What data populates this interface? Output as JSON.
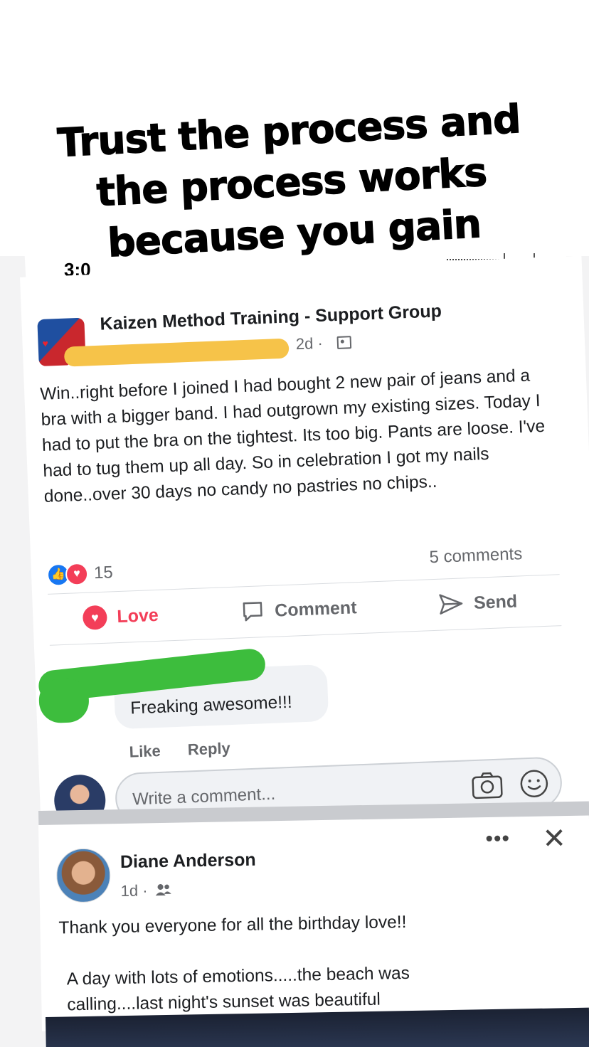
{
  "headline": "Trust the process and the process works because you gain consistency!",
  "status_bar": {
    "time": "3:0"
  },
  "post1": {
    "group_name": "Kaizen Method Training - Support Group",
    "time": "2d ·",
    "body": "Win..right before I joined I had bought 2 new pair of jeans and a bra with a bigger band. I had outgrown my existing sizes. Today I had to put the bra on the tightest. Its too big. Pants are loose. I've had to tug them up all day.  So in celebration I got my nails done..over 30 days no candy no pastries no chips..",
    "reaction_count": "15",
    "comments_count": "5 comments",
    "actions": {
      "love": "Love",
      "comment": "Comment",
      "send": "Send"
    },
    "comment": {
      "text": "Freaking awesome!!!",
      "like": "Like",
      "reply": "Reply"
    },
    "write_comment_placeholder": "Write a comment..."
  },
  "post2": {
    "name": "Diane Anderson",
    "time": "1d ·",
    "body_line1": "Thank you everyone for all the birthday love!!",
    "body_line2": "A day with lots of emotions.....the beach was calling....last night's sunset was beautiful"
  },
  "colors": {
    "love_red": "#f33e58",
    "like_blue": "#1877f2",
    "redaction_yellow": "#f6c349",
    "redaction_green": "#3dbd3d",
    "secondary_text": "#65676b"
  }
}
